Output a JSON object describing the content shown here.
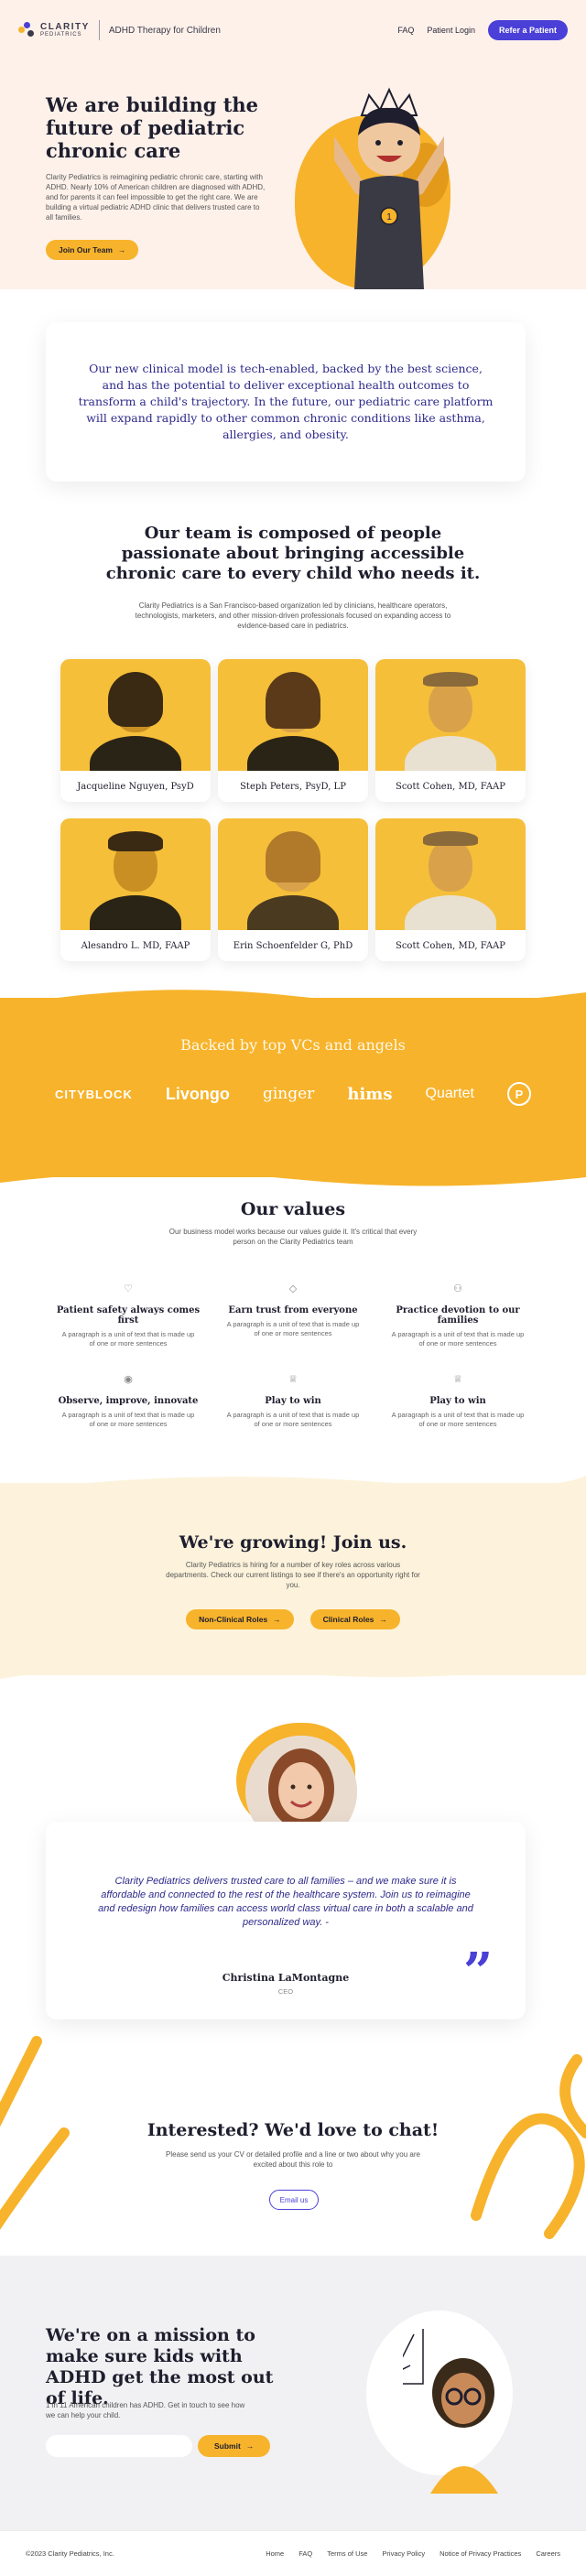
{
  "header": {
    "logo_name": "CLARITY",
    "logo_sub": "PEDIATRICS",
    "tagline": "ADHD Therapy for Children",
    "nav": [
      "FAQ",
      "Patient Login"
    ],
    "refer_label": "Refer a Patient"
  },
  "hero": {
    "title": "We are building the future of pediatric chronic care",
    "body": "Clarity Pediatrics is reimagining pediatric chronic care, starting with ADHD. Nearly 10% of American children are diagnosed with ADHD, and for parents it can feel impossible to get the right care. We are building a virtual pediatric ADHD clinic that delivers trusted care to all families.",
    "cta": "Join Our Team",
    "badge": "1"
  },
  "mission": {
    "text": "Our new clinical model is tech-enabled, backed by the best science, and has the potential to deliver exceptional health outcomes to transform a child's trajectory. In the future, our pediatric care platform will expand rapidly to other common chronic conditions like asthma, allergies, and obesity."
  },
  "team": {
    "title": "Our team is composed of people passionate about bringing accessible chronic care to every child who needs it.",
    "description": "Clarity Pediatrics is a San Francisco-based organization led by clinicians, healthcare operators, technologists, marketers, and other mission-driven professionals focused on expanding access to evidence-based care in pediatrics.",
    "members": [
      {
        "name": "Jacqueline Nguyen, PsyD"
      },
      {
        "name": "Steph Peters, PsyD, LP"
      },
      {
        "name": "Scott Cohen, MD, FAAP"
      },
      {
        "name": "Alesandro L. MD, FAAP"
      },
      {
        "name": "Erin Schoenfelder G, PhD"
      },
      {
        "name": "Scott Cohen, MD, FAAP"
      }
    ]
  },
  "backers": {
    "title": "Backed by top VCs and angels",
    "logos": [
      "CITYBLOCK",
      "Livongo",
      "ginger",
      "hims",
      "Quartet",
      "P"
    ]
  },
  "values": {
    "title": "Our values",
    "description": "Our business model works because our values guide it. It's critical that every person on the Clarity Pediatrics team",
    "items": [
      {
        "icon": "heart-icon",
        "glyph": "♡",
        "title": "Patient safety always comes first",
        "text": "A paragraph is a unit of text that is made up of one or more sentences"
      },
      {
        "icon": "diamond-icon",
        "glyph": "◇",
        "title": "Earn trust from everyone",
        "text": "A paragraph is a unit of text that is made up of one or more sentences"
      },
      {
        "icon": "people-icon",
        "glyph": "⚇",
        "title": "Practice devotion to our families",
        "text": "A paragraph is a unit of text that is made up of one or more sentences"
      },
      {
        "icon": "eye-icon",
        "glyph": "◉",
        "title": "Observe, improve, innovate",
        "text": "A paragraph is a unit of text that is made up of one or more sentences"
      },
      {
        "icon": "trophy-icon",
        "glyph": "♕",
        "title": "Play to win",
        "text": "A paragraph is a unit of text that is made up of one or more sentences"
      },
      {
        "icon": "trophy-icon",
        "glyph": "♕",
        "title": "Play to win",
        "text": "A paragraph is a unit of text that is made up of one or more sentences"
      }
    ]
  },
  "growing": {
    "title": "We're growing! Join us.",
    "description": "Clarity Pediatrics is hiring for a number of key roles across various departments. Check our current listings to see if there's an opportunity right for you.",
    "buttons": [
      "Non-Clinical Roles",
      "Clinical Roles"
    ]
  },
  "testimonial": {
    "quote": "Clarity Pediatrics delivers trusted care to all families – and we make sure it is affordable and connected to the rest of the healthcare system. Join us to reimagine and redesign how families can access world class virtual care in both a scalable and personalized way. -",
    "name": "Christina LaMontagne",
    "role": "CEO"
  },
  "interested": {
    "title": "Interested? We'd love to chat!",
    "description": "Please send us your CV or detailed profile and a line or two about why you are excited about this role to",
    "email_label": "Email us"
  },
  "cta": {
    "title": "We're on a mission to make sure kids with ADHD get the most out of life.",
    "description": "1 in 11 American children has ADHD. Get in touch to see how we can help your child.",
    "email_placeholder": "",
    "submit_label": "Submit"
  },
  "footer": {
    "copyright": "©2023 Clarity Pediatrics, Inc.",
    "links": [
      "Home",
      "FAQ",
      "Terms of Use",
      "Privacy Policy",
      "Notice of Privacy Practices",
      "Careers"
    ]
  },
  "colors": {
    "accent_yellow": "#f7b32b",
    "accent_purple": "#4a3fd6",
    "hero_bg": "#fdf1ea"
  }
}
